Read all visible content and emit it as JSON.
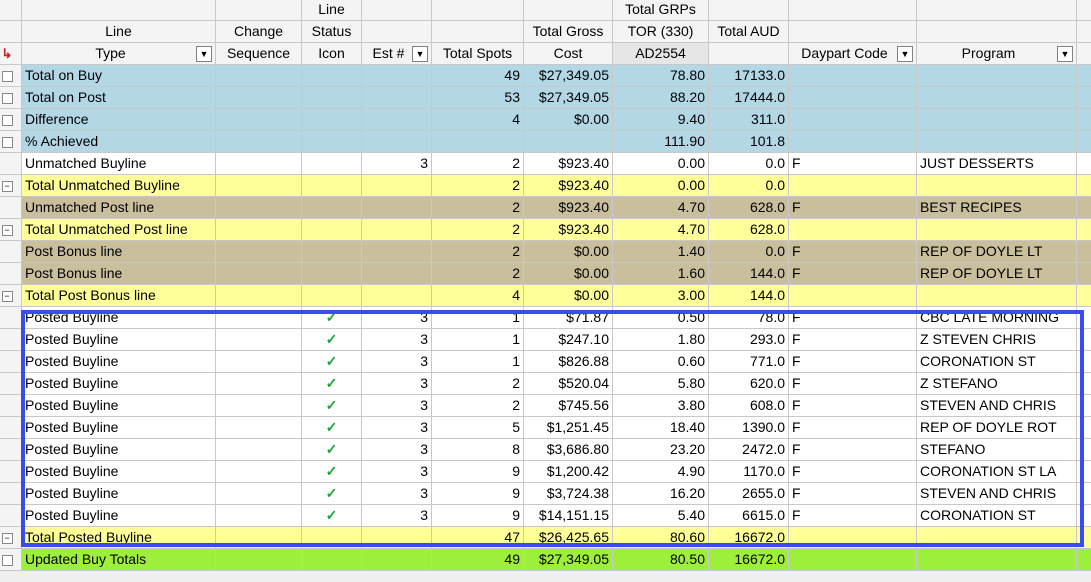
{
  "headers": {
    "row1": {
      "line_status": "Line",
      "total_grps": "Total GRPs"
    },
    "row2": {
      "line": "Line",
      "change": "Change",
      "line_status": "Status",
      "total_gross": "Total Gross",
      "tor": "TOR (330)",
      "total_aud": "Total AUD"
    },
    "row3": {
      "type": "Type",
      "sequence": "Sequence",
      "icon": "Icon",
      "est": "Est #",
      "total_spots": "Total Spots",
      "cost": "Cost",
      "ad": "AD2554",
      "daypart": "Daypart Code",
      "program": "Program"
    }
  },
  "icons": {
    "header_marker": "arrow-icon",
    "dropdown": "dropdown-arrow-icon",
    "status_ok": "checkmark-icon"
  },
  "colors": {
    "blue": "#b4d7e6",
    "yellow": "#ffff9a",
    "tan": "#c9bf9c",
    "green": "#9eee3c",
    "white": "#ffffff",
    "highlight": "#3a4cf0",
    "check": "#1aa53a"
  },
  "rows": [
    {
      "ctrl": "box",
      "type": "Total on Buy",
      "color": "blue",
      "seq": "",
      "icon": "",
      "est": "",
      "spots": "49",
      "cost": "$27,349.05",
      "tor": "78.80",
      "aud": "17133.0",
      "daypart": "",
      "program": ""
    },
    {
      "ctrl": "box",
      "type": "Total on Post",
      "color": "blue",
      "seq": "",
      "icon": "",
      "est": "",
      "spots": "53",
      "cost": "$27,349.05",
      "tor": "88.20",
      "aud": "17444.0",
      "daypart": "",
      "program": ""
    },
    {
      "ctrl": "box",
      "type": "Difference",
      "color": "blue",
      "seq": "",
      "icon": "",
      "est": "",
      "spots": "4",
      "cost": "$0.00",
      "tor": "9.40",
      "aud": "311.0",
      "daypart": "",
      "program": ""
    },
    {
      "ctrl": "box",
      "type": "% Achieved",
      "color": "blue",
      "seq": "",
      "icon": "",
      "est": "",
      "spots": "",
      "cost": "",
      "tor": "111.90",
      "aud": "101.8",
      "daypart": "",
      "program": ""
    },
    {
      "ctrl": "",
      "type": "Unmatched Buyline",
      "color": "white",
      "seq": "",
      "icon": "",
      "est": "3",
      "spots": "2",
      "cost": "$923.40",
      "tor": "0.00",
      "aud": "0.0",
      "daypart": "F",
      "program": "JUST DESSERTS"
    },
    {
      "ctrl": "minus",
      "type": "Total Unmatched Buyline",
      "color": "yellow",
      "seq": "",
      "icon": "",
      "est": "",
      "spots": "2",
      "cost": "$923.40",
      "tor": "0.00",
      "aud": "0.0",
      "daypart": "",
      "program": ""
    },
    {
      "ctrl": "",
      "type": "Unmatched Post line",
      "color": "tan",
      "seq": "",
      "icon": "",
      "est": "",
      "spots": "2",
      "cost": "$923.40",
      "tor": "4.70",
      "aud": "628.0",
      "daypart": "F",
      "program": "BEST RECIPES"
    },
    {
      "ctrl": "minus",
      "type": "Total Unmatched Post line",
      "color": "yellow",
      "seq": "",
      "icon": "",
      "est": "",
      "spots": "2",
      "cost": "$923.40",
      "tor": "4.70",
      "aud": "628.0",
      "daypart": "",
      "program": ""
    },
    {
      "ctrl": "",
      "type": "Post Bonus line",
      "color": "tan",
      "seq": "",
      "icon": "",
      "est": "",
      "spots": "2",
      "cost": "$0.00",
      "tor": "1.40",
      "aud": "0.0",
      "daypart": "F",
      "program": "REP OF DOYLE LT"
    },
    {
      "ctrl": "",
      "type": "Post Bonus line",
      "color": "tan",
      "seq": "",
      "icon": "",
      "est": "",
      "spots": "2",
      "cost": "$0.00",
      "tor": "1.60",
      "aud": "144.0",
      "daypart": "F",
      "program": "REP OF DOYLE LT"
    },
    {
      "ctrl": "minus",
      "type": "Total Post Bonus line",
      "color": "yellow",
      "seq": "",
      "icon": "",
      "est": "",
      "spots": "4",
      "cost": "$0.00",
      "tor": "3.00",
      "aud": "144.0",
      "daypart": "",
      "program": ""
    },
    {
      "ctrl": "",
      "type": "Posted Buyline",
      "color": "white",
      "seq": "",
      "icon": "✓",
      "est": "3",
      "spots": "1",
      "cost": "$71.87",
      "tor": "0.50",
      "aud": "78.0",
      "daypart": "F",
      "program": "CBC LATE MORNING"
    },
    {
      "ctrl": "",
      "type": "Posted Buyline",
      "color": "white",
      "seq": "",
      "icon": "✓",
      "est": "3",
      "spots": "1",
      "cost": "$247.10",
      "tor": "1.80",
      "aud": "293.0",
      "daypart": "F",
      "program": "Z STEVEN  CHRIS"
    },
    {
      "ctrl": "",
      "type": "Posted Buyline",
      "color": "white",
      "seq": "",
      "icon": "✓",
      "est": "3",
      "spots": "1",
      "cost": "$826.88",
      "tor": "0.60",
      "aud": "771.0",
      "daypart": "F",
      "program": "CORONATION ST"
    },
    {
      "ctrl": "",
      "type": "Posted Buyline",
      "color": "white",
      "seq": "",
      "icon": "✓",
      "est": "3",
      "spots": "2",
      "cost": "$520.04",
      "tor": "5.80",
      "aud": "620.0",
      "daypart": "F",
      "program": "Z STEFANO"
    },
    {
      "ctrl": "",
      "type": "Posted Buyline",
      "color": "white",
      "seq": "",
      "icon": "✓",
      "est": "3",
      "spots": "2",
      "cost": "$745.56",
      "tor": "3.80",
      "aud": "608.0",
      "daypart": "F",
      "program": "STEVEN AND CHRIS"
    },
    {
      "ctrl": "",
      "type": "Posted Buyline",
      "color": "white",
      "seq": "",
      "icon": "✓",
      "est": "3",
      "spots": "5",
      "cost": "$1,251.45",
      "tor": "18.40",
      "aud": "1390.0",
      "daypart": "F",
      "program": "REP OF DOYLE ROT"
    },
    {
      "ctrl": "",
      "type": "Posted Buyline",
      "color": "white",
      "seq": "",
      "icon": "✓",
      "est": "3",
      "spots": "8",
      "cost": "$3,686.80",
      "tor": "23.20",
      "aud": "2472.0",
      "daypart": "F",
      "program": "STEFANO"
    },
    {
      "ctrl": "",
      "type": "Posted Buyline",
      "color": "white",
      "seq": "",
      "icon": "✓",
      "est": "3",
      "spots": "9",
      "cost": "$1,200.42",
      "tor": "4.90",
      "aud": "1170.0",
      "daypart": "F",
      "program": "CORONATION ST LA"
    },
    {
      "ctrl": "",
      "type": "Posted Buyline",
      "color": "white",
      "seq": "",
      "icon": "✓",
      "est": "3",
      "spots": "9",
      "cost": "$3,724.38",
      "tor": "16.20",
      "aud": "2655.0",
      "daypart": "F",
      "program": "STEVEN AND CHRIS"
    },
    {
      "ctrl": "",
      "type": "Posted Buyline",
      "color": "white",
      "seq": "",
      "icon": "✓",
      "est": "3",
      "spots": "9",
      "cost": "$14,151.15",
      "tor": "5.40",
      "aud": "6615.0",
      "daypart": "F",
      "program": "CORONATION ST"
    },
    {
      "ctrl": "minus",
      "type": "Total Posted Buyline",
      "color": "yellow",
      "seq": "",
      "icon": "",
      "est": "",
      "spots": "47",
      "cost": "$26,425.65",
      "tor": "80.60",
      "aud": "16672.0",
      "daypart": "",
      "program": ""
    },
    {
      "ctrl": "box",
      "type": "Updated Buy Totals",
      "color": "green",
      "seq": "",
      "icon": "",
      "est": "",
      "spots": "49",
      "cost": "$27,349.05",
      "tor": "80.50",
      "aud": "16672.0",
      "daypart": "",
      "program": ""
    }
  ]
}
